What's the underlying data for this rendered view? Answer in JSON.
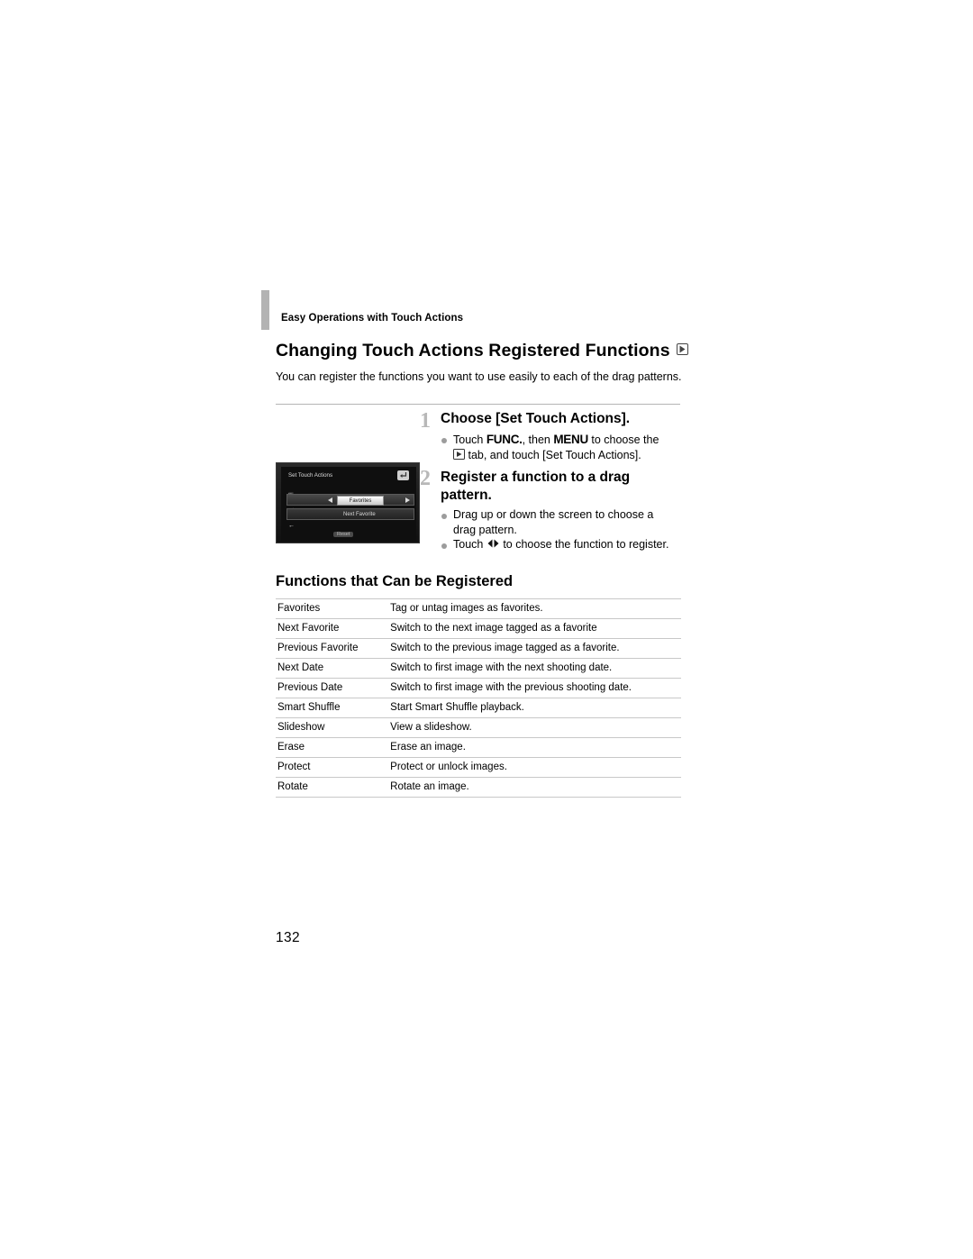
{
  "header": {
    "running_head": "Easy Operations with Touch Actions"
  },
  "title": {
    "text": "Changing Touch Actions Registered Functions",
    "trailing_icon": "arrow-box-icon"
  },
  "intro": "You can register the functions you want to use easily to each of the drag patterns.",
  "steps": [
    {
      "number": "1",
      "heading": "Choose [Set Touch Actions].",
      "bullets": [
        "Touch FUNC., then MENU to choose the ▶ tab, and touch [Set Touch Actions]."
      ]
    },
    {
      "number": "2",
      "heading": "Register a function to a drag pattern.",
      "bullets": [
        "Drag up or down the screen to choose a drag pattern.",
        "Touch ◀▶ to choose the function to register."
      ]
    }
  ],
  "bullet_parts": {
    "s1_pre": "Touch ",
    "s1_func": "FUNC.",
    "s1_mid": ", then ",
    "s1_menu": "MENU",
    "s1_post": " to choose the",
    "s1_line2_pre": " tab, and touch [Set Touch Actions].",
    "s2_b1": "Drag up or down the screen to choose a drag pattern.",
    "s2_b2_pre": "Touch ",
    "s2_b2_post": " to choose the function to register."
  },
  "camera_screen": {
    "title": "Set Touch Actions",
    "back_icon": "return-arrow-icon",
    "row1_gesture": "drag-up-icon",
    "row1_value": "Favorites",
    "row2_gesture": "drag-down-icon",
    "row2_value": "Next Favorite",
    "footer_hint": "Reset"
  },
  "subsection": {
    "heading": "Functions that Can be Registered"
  },
  "table": {
    "rows": [
      {
        "name": "Favorites",
        "desc": "Tag or untag images as favorites."
      },
      {
        "name": "Next Favorite",
        "desc": "Switch to the next image tagged as a favorite"
      },
      {
        "name": "Previous Favorite",
        "desc": "Switch to the previous image tagged as a favorite."
      },
      {
        "name": "Next Date",
        "desc": "Switch to first image with the next shooting date."
      },
      {
        "name": "Previous Date",
        "desc": "Switch to first image with the previous shooting date."
      },
      {
        "name": "Smart Shuffle",
        "desc": "Start Smart Shuffle playback."
      },
      {
        "name": "Slideshow",
        "desc": "View a slideshow."
      },
      {
        "name": "Erase",
        "desc": "Erase an image."
      },
      {
        "name": "Protect",
        "desc": "Protect or unlock images."
      },
      {
        "name": "Rotate",
        "desc": "Rotate an image."
      }
    ]
  },
  "footer": {
    "page_number": "132"
  },
  "colors": {
    "accent_gray": "#b3b3b3",
    "rule": "#c8c8c8",
    "bullet": "#9c9c9c",
    "step_number": "#b8b8b8"
  }
}
